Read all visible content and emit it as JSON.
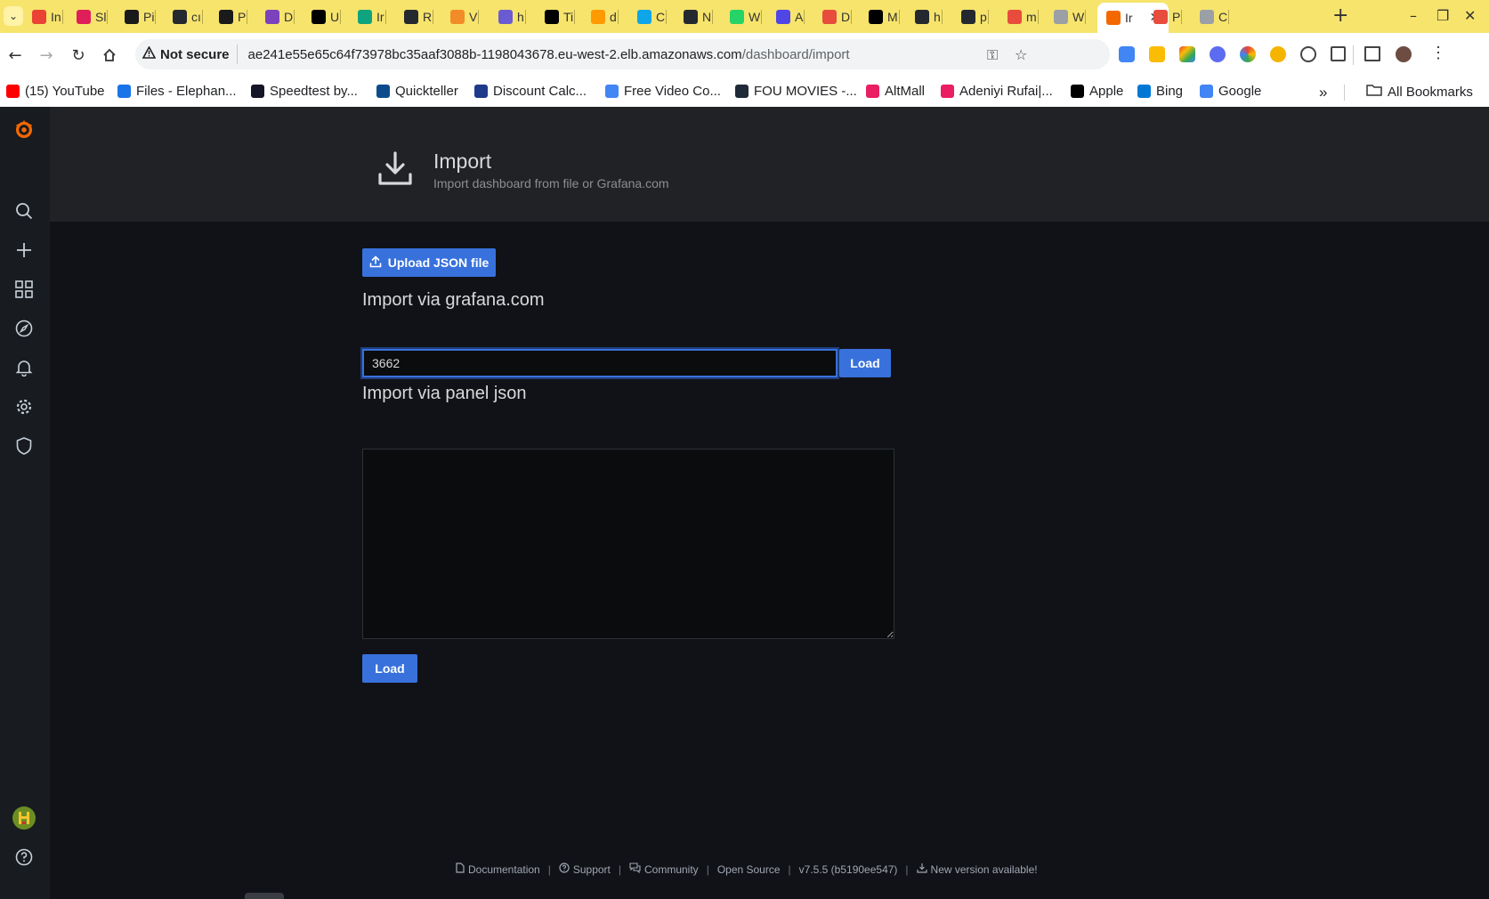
{
  "browser": {
    "tabs": [
      {
        "label": "In",
        "color": "#ea4335"
      },
      {
        "label": "Sl",
        "color": "#e01e5a"
      },
      {
        "label": "Pi",
        "color": "#1a1a1a"
      },
      {
        "label": "cı",
        "color": "#24292f"
      },
      {
        "label": "P",
        "color": "#1a1a1a"
      },
      {
        "label": "D",
        "color": "#7b42bc"
      },
      {
        "label": "U",
        "color": "#000000"
      },
      {
        "label": "Ir",
        "color": "#10a37f"
      },
      {
        "label": "R",
        "color": "#24292f"
      },
      {
        "label": "V",
        "color": "#f28c28"
      },
      {
        "label": "h",
        "color": "#6b5bd2"
      },
      {
        "label": "Ti",
        "color": "#000000"
      },
      {
        "label": "d",
        "color": "#ff9a00"
      },
      {
        "label": "C",
        "color": "#0ea5e9"
      },
      {
        "label": "N",
        "color": "#24292f"
      },
      {
        "label": "W",
        "color": "#25d366"
      },
      {
        "label": "A",
        "color": "#4f46e5"
      },
      {
        "label": "D",
        "color": "#e74c3c"
      },
      {
        "label": "M",
        "color": "#000000"
      },
      {
        "label": "h",
        "color": "#24292f"
      },
      {
        "label": "p",
        "color": "#24292f"
      },
      {
        "label": "m",
        "color": "#e74c3c"
      },
      {
        "label": "W",
        "color": "#9aa0a6"
      },
      {
        "label": "Ir",
        "color": "#f46800",
        "active": true
      },
      {
        "label": "P",
        "color": "#e74c3c"
      },
      {
        "label": "C",
        "color": "#9aa0a6"
      }
    ],
    "address": {
      "security_label": "Not secure",
      "url_host": "ae241e55e65c64f73978bc35aaf3088b-1198043678.eu-west-2.elb.amazonaws.com",
      "url_path": "/dashboard/import"
    },
    "bookmarks": [
      {
        "label": "(15) YouTube",
        "color": "#ff0000"
      },
      {
        "label": "Files - Elephan...",
        "color": "#1a73e8"
      },
      {
        "label": "Speedtest by...",
        "color": "#141526"
      },
      {
        "label": "Quickteller",
        "color": "#0c4a8b"
      },
      {
        "label": "Discount Calc...",
        "color": "#1e3a8a"
      },
      {
        "label": "Free Video Co...",
        "color": "#4285f4"
      },
      {
        "label": "FOU MOVIES -...",
        "color": "#1f2937"
      },
      {
        "label": "AltMall",
        "color": "#e91e63"
      },
      {
        "label": "Adeniyi Rufai|...",
        "color": "#e91e63"
      },
      {
        "label": "Apple",
        "color": "#000000"
      },
      {
        "label": "Bing",
        "color": "#0078d4"
      },
      {
        "label": "Google",
        "color": "#4285f4"
      }
    ],
    "all_bookmarks_label": "All Bookmarks"
  },
  "grafana": {
    "header": {
      "title": "Import",
      "subtitle": "Import dashboard from file or Grafana.com"
    },
    "upload_button_label": "Upload JSON file",
    "grafana_com": {
      "heading": "Import via grafana.com",
      "input_value": "3662",
      "load_label": "Load"
    },
    "panel_json": {
      "heading": "Import via panel json",
      "value": "",
      "load_label": "Load"
    },
    "footer": {
      "documentation": "Documentation",
      "support": "Support",
      "community": "Community",
      "open_source": "Open Source",
      "version": "v7.5.5 (b5190ee547)",
      "new_version": "New version available!"
    },
    "colors": {
      "primary": "#3871dc",
      "sidebar": "#181b1f",
      "header": "#202226",
      "background": "#111217",
      "logo": "#f46800"
    }
  }
}
